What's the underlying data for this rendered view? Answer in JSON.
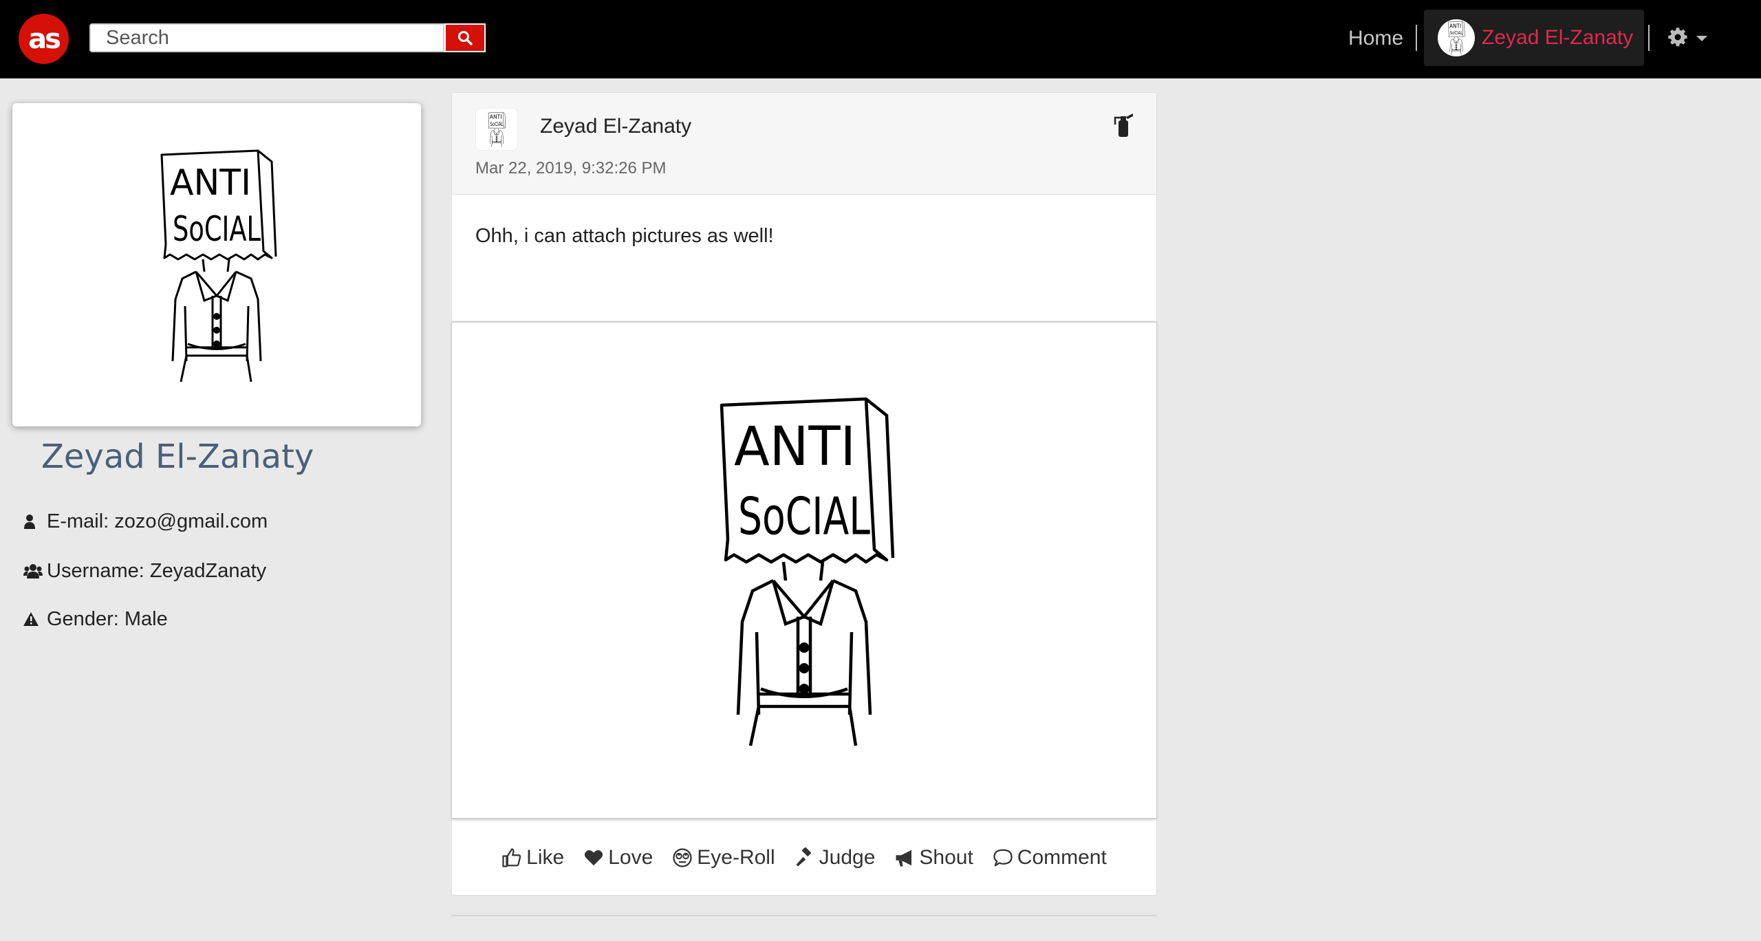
{
  "navbar": {
    "logo_text": "as",
    "search_placeholder": "Search",
    "home_label": "Home",
    "user_name": "Zeyad El-Zanaty"
  },
  "profile": {
    "name": "Zeyad El-Zanaty",
    "email_label": "E-mail: zozo@gmail.com",
    "username_label": "Username: ZeyadZanaty",
    "gender_label": "Gender: Male"
  },
  "post": {
    "author": "Zeyad El-Zanaty",
    "date": "Mar 22, 2019, 9:32:26 PM",
    "text": "Ohh, i can attach pictures as well!",
    "image_text_line1": "ANTI",
    "image_text_line2": "SoCIAL",
    "actions": {
      "like": "Like",
      "love": "Love",
      "eyeroll": "Eye-Roll",
      "judge": "Judge",
      "shout": "Shout",
      "comment": "Comment"
    }
  },
  "colors": {
    "brand_red": "#d51007",
    "user_name_pink": "#e0294f",
    "navbar_bg": "#000000",
    "page_bg": "#e9e9e9",
    "profile_name": "#4a6078"
  }
}
